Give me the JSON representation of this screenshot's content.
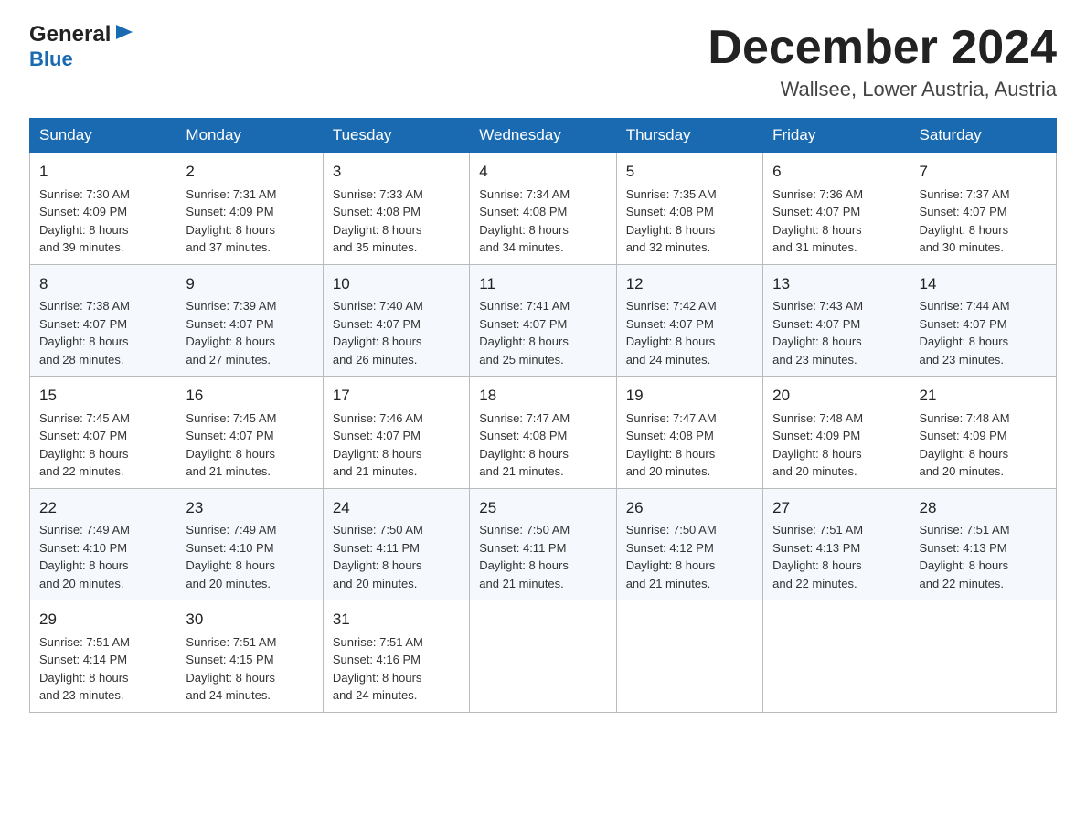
{
  "header": {
    "logo_general": "General",
    "logo_blue": "Blue",
    "month_title": "December 2024",
    "location": "Wallsee, Lower Austria, Austria"
  },
  "days_of_week": [
    "Sunday",
    "Monday",
    "Tuesday",
    "Wednesday",
    "Thursday",
    "Friday",
    "Saturday"
  ],
  "weeks": [
    [
      {
        "day": "1",
        "sunrise": "7:30 AM",
        "sunset": "4:09 PM",
        "daylight": "8 hours and 39 minutes."
      },
      {
        "day": "2",
        "sunrise": "7:31 AM",
        "sunset": "4:09 PM",
        "daylight": "8 hours and 37 minutes."
      },
      {
        "day": "3",
        "sunrise": "7:33 AM",
        "sunset": "4:08 PM",
        "daylight": "8 hours and 35 minutes."
      },
      {
        "day": "4",
        "sunrise": "7:34 AM",
        "sunset": "4:08 PM",
        "daylight": "8 hours and 34 minutes."
      },
      {
        "day": "5",
        "sunrise": "7:35 AM",
        "sunset": "4:08 PM",
        "daylight": "8 hours and 32 minutes."
      },
      {
        "day": "6",
        "sunrise": "7:36 AM",
        "sunset": "4:07 PM",
        "daylight": "8 hours and 31 minutes."
      },
      {
        "day": "7",
        "sunrise": "7:37 AM",
        "sunset": "4:07 PM",
        "daylight": "8 hours and 30 minutes."
      }
    ],
    [
      {
        "day": "8",
        "sunrise": "7:38 AM",
        "sunset": "4:07 PM",
        "daylight": "8 hours and 28 minutes."
      },
      {
        "day": "9",
        "sunrise": "7:39 AM",
        "sunset": "4:07 PM",
        "daylight": "8 hours and 27 minutes."
      },
      {
        "day": "10",
        "sunrise": "7:40 AM",
        "sunset": "4:07 PM",
        "daylight": "8 hours and 26 minutes."
      },
      {
        "day": "11",
        "sunrise": "7:41 AM",
        "sunset": "4:07 PM",
        "daylight": "8 hours and 25 minutes."
      },
      {
        "day": "12",
        "sunrise": "7:42 AM",
        "sunset": "4:07 PM",
        "daylight": "8 hours and 24 minutes."
      },
      {
        "day": "13",
        "sunrise": "7:43 AM",
        "sunset": "4:07 PM",
        "daylight": "8 hours and 23 minutes."
      },
      {
        "day": "14",
        "sunrise": "7:44 AM",
        "sunset": "4:07 PM",
        "daylight": "8 hours and 23 minutes."
      }
    ],
    [
      {
        "day": "15",
        "sunrise": "7:45 AM",
        "sunset": "4:07 PM",
        "daylight": "8 hours and 22 minutes."
      },
      {
        "day": "16",
        "sunrise": "7:45 AM",
        "sunset": "4:07 PM",
        "daylight": "8 hours and 21 minutes."
      },
      {
        "day": "17",
        "sunrise": "7:46 AM",
        "sunset": "4:07 PM",
        "daylight": "8 hours and 21 minutes."
      },
      {
        "day": "18",
        "sunrise": "7:47 AM",
        "sunset": "4:08 PM",
        "daylight": "8 hours and 21 minutes."
      },
      {
        "day": "19",
        "sunrise": "7:47 AM",
        "sunset": "4:08 PM",
        "daylight": "8 hours and 20 minutes."
      },
      {
        "day": "20",
        "sunrise": "7:48 AM",
        "sunset": "4:09 PM",
        "daylight": "8 hours and 20 minutes."
      },
      {
        "day": "21",
        "sunrise": "7:48 AM",
        "sunset": "4:09 PM",
        "daylight": "8 hours and 20 minutes."
      }
    ],
    [
      {
        "day": "22",
        "sunrise": "7:49 AM",
        "sunset": "4:10 PM",
        "daylight": "8 hours and 20 minutes."
      },
      {
        "day": "23",
        "sunrise": "7:49 AM",
        "sunset": "4:10 PM",
        "daylight": "8 hours and 20 minutes."
      },
      {
        "day": "24",
        "sunrise": "7:50 AM",
        "sunset": "4:11 PM",
        "daylight": "8 hours and 20 minutes."
      },
      {
        "day": "25",
        "sunrise": "7:50 AM",
        "sunset": "4:11 PM",
        "daylight": "8 hours and 21 minutes."
      },
      {
        "day": "26",
        "sunrise": "7:50 AM",
        "sunset": "4:12 PM",
        "daylight": "8 hours and 21 minutes."
      },
      {
        "day": "27",
        "sunrise": "7:51 AM",
        "sunset": "4:13 PM",
        "daylight": "8 hours and 22 minutes."
      },
      {
        "day": "28",
        "sunrise": "7:51 AM",
        "sunset": "4:13 PM",
        "daylight": "8 hours and 22 minutes."
      }
    ],
    [
      {
        "day": "29",
        "sunrise": "7:51 AM",
        "sunset": "4:14 PM",
        "daylight": "8 hours and 23 minutes."
      },
      {
        "day": "30",
        "sunrise": "7:51 AM",
        "sunset": "4:15 PM",
        "daylight": "8 hours and 24 minutes."
      },
      {
        "day": "31",
        "sunrise": "7:51 AM",
        "sunset": "4:16 PM",
        "daylight": "8 hours and 24 minutes."
      },
      null,
      null,
      null,
      null
    ]
  ],
  "labels": {
    "sunrise": "Sunrise:",
    "sunset": "Sunset:",
    "daylight": "Daylight:"
  }
}
